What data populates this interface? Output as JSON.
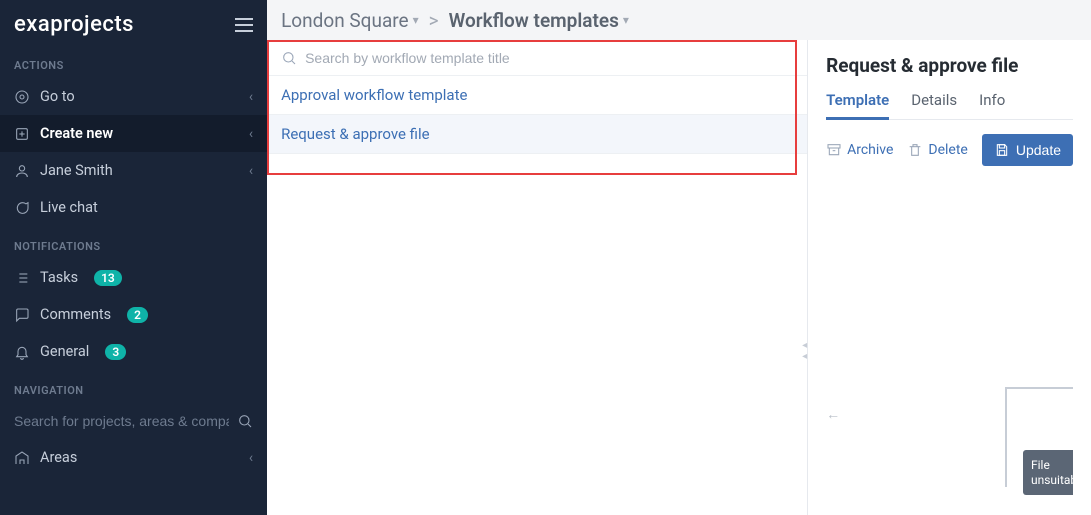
{
  "brand": "exaprojects",
  "sidebar": {
    "sections": {
      "actions": "ACTIONS",
      "notifications": "NOTIFICATIONS",
      "navigation": "NAVIGATION"
    },
    "items": {
      "goto": "Go to",
      "create_new": "Create new",
      "user": "Jane Smith",
      "live_chat": "Live chat",
      "tasks": "Tasks",
      "tasks_count": "13",
      "comments": "Comments",
      "comments_count": "2",
      "general": "General",
      "general_count": "3",
      "areas": "Areas"
    },
    "search_placeholder": "Search for projects, areas & companies"
  },
  "breadcrumb": {
    "project": "London Square",
    "separator": ">",
    "page": "Workflow templates"
  },
  "list": {
    "search_placeholder": "Search by workflow template title",
    "items": [
      "Approval workflow template",
      "Request & approve file"
    ]
  },
  "right": {
    "title": "Request & approve file",
    "tabs": [
      "Template",
      "Details",
      "Info"
    ],
    "archive": "Archive",
    "delete": "Delete",
    "update": "Update",
    "node_label": "File unsuitable"
  }
}
